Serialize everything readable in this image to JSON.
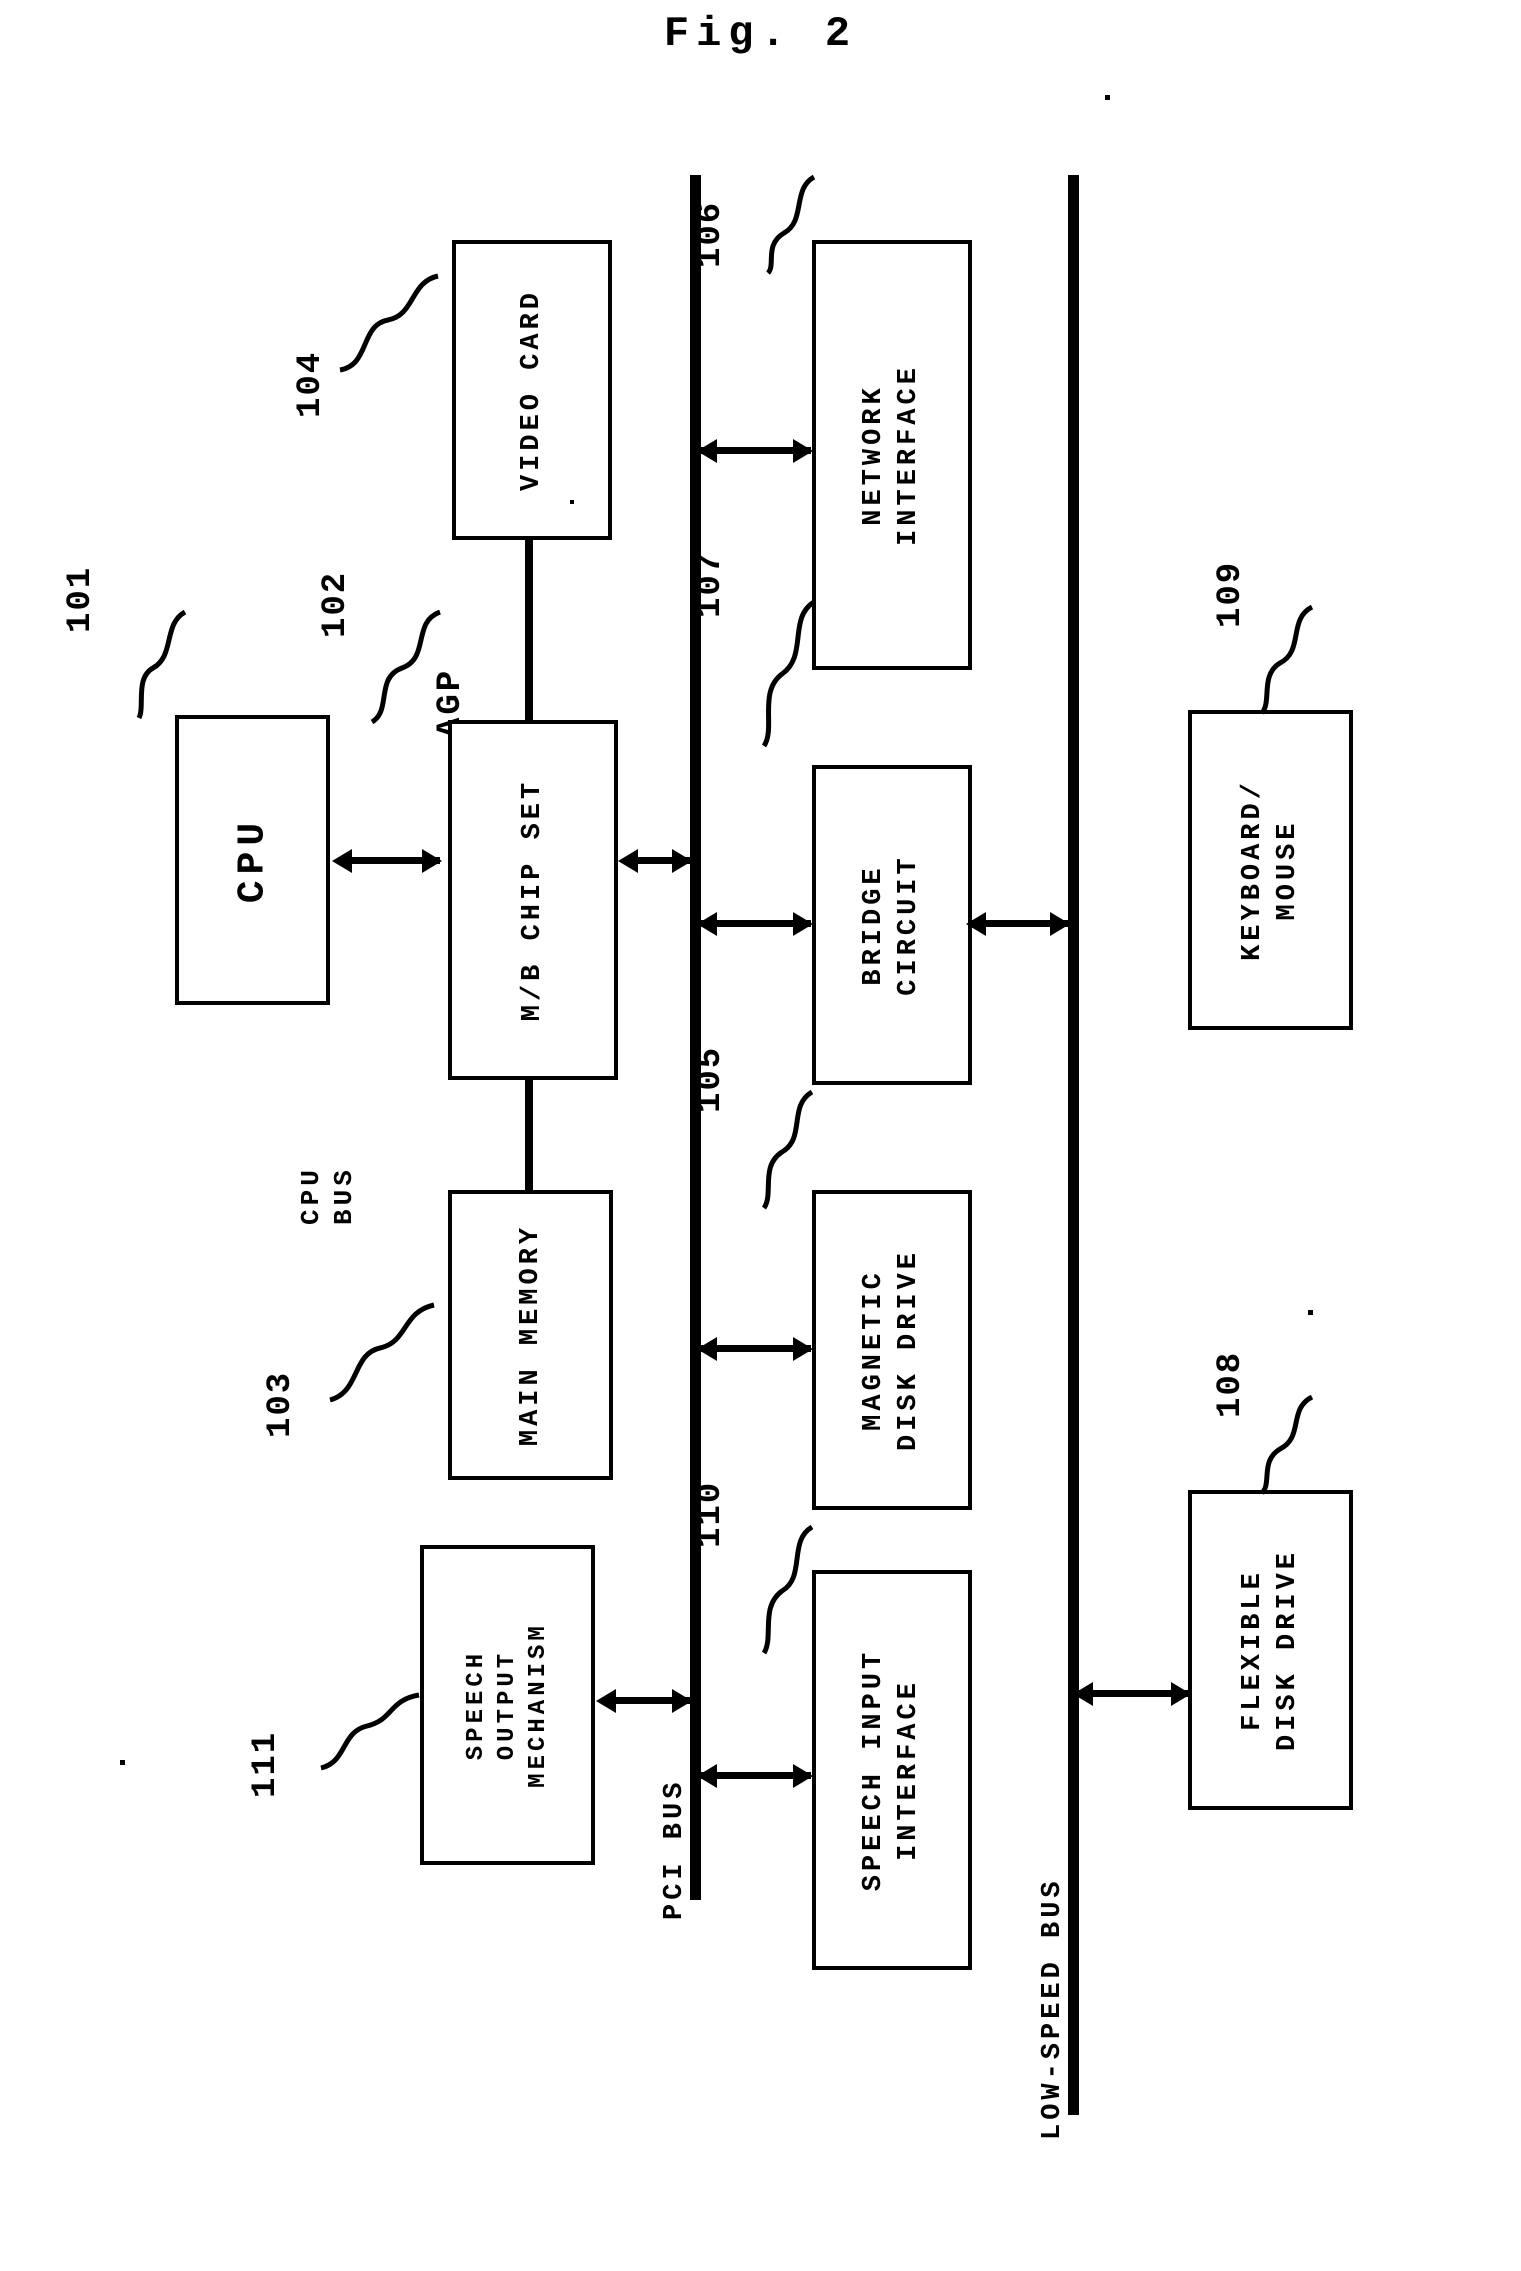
{
  "figure": {
    "title": "Fig. 2",
    "type": "patent-block-diagram",
    "orientation": "rotated-90-ccw",
    "line_color": "#000000",
    "background_color": "#ffffff"
  },
  "blocks": [
    {
      "id": "cpu",
      "ref": "101",
      "label": "CPU"
    },
    {
      "id": "mb-chip-set",
      "ref": "102",
      "label": "M/B CHIP SET"
    },
    {
      "id": "main-memory",
      "ref": "103",
      "label": "MAIN MEMORY"
    },
    {
      "id": "video-card",
      "ref": "104",
      "label": "VIDEO CARD"
    },
    {
      "id": "magnetic-disk-drive",
      "ref": "105",
      "label_line1": "MAGNETIC",
      "label_line2": "DISK DRIVE"
    },
    {
      "id": "network-interface",
      "ref": "106",
      "label_line1": "NETWORK",
      "label_line2": "INTERFACE"
    },
    {
      "id": "bridge-circuit",
      "ref": "107",
      "label_line1": "BRIDGE",
      "label_line2": "CIRCUIT"
    },
    {
      "id": "flexible-disk-drive",
      "ref": "108",
      "label_line1": "FLEXIBLE",
      "label_line2": "DISK DRIVE"
    },
    {
      "id": "keyboard-mouse",
      "ref": "109",
      "label_line1": "KEYBOARD/",
      "label_line2": "MOUSE"
    },
    {
      "id": "speech-input-interface",
      "ref": "110",
      "label_line1": "SPEECH INPUT",
      "label_line2": "INTERFACE"
    },
    {
      "id": "speech-output-mechanism",
      "ref": "111",
      "label_line1": "SPEECH",
      "label_line2": "OUTPUT",
      "label_line3": "MECHANISM"
    }
  ],
  "bus_labels": {
    "agp": "AGP",
    "cpu_bus_line1": "CPU",
    "cpu_bus_line2": "BUS",
    "pci_bus": "PCI BUS",
    "low_speed_bus": "LOW-SPEED BUS"
  },
  "reference_numerals": [
    "101",
    "102",
    "103",
    "104",
    "105",
    "106",
    "107",
    "108",
    "109",
    "110",
    "111"
  ]
}
